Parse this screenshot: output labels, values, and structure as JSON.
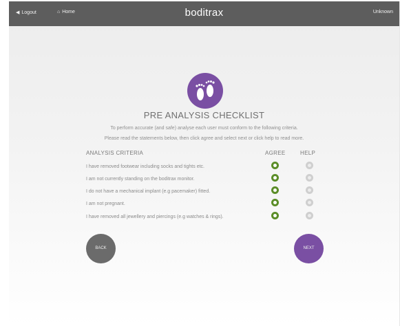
{
  "topbar": {
    "logout_label": "Logout",
    "home_label": "Home",
    "brand": "boditrax",
    "user_label": "Unknown"
  },
  "checklist": {
    "title": "PRE ANALYSIS CHECKLIST",
    "intro_line1": "To perform accurate (and safe) analyse each user must conform to the following criteria.",
    "intro_line2": "Please read the statements below, then click agree and select next or click help to read more.",
    "header_criteria": "ANALYSIS CRITERIA",
    "header_agree": "AGREE",
    "header_help": "HELP",
    "items": [
      {
        "text": "I have removed footwear including socks and tights etc.",
        "agreed": true
      },
      {
        "text": "I am not currently standing on the boditrax monitor.",
        "agreed": true
      },
      {
        "text": "I do not have a mechanical implant (e.g pacemaker) fitted.",
        "agreed": true
      },
      {
        "text": "I am not pregnant.",
        "agreed": true
      },
      {
        "text": "I have removed all jewellery and piercings (e.g watches & rings).",
        "agreed": true
      }
    ]
  },
  "buttons": {
    "back_label": "BACK",
    "next_label": "NEXT"
  },
  "colors": {
    "accent": "#7a4fa3",
    "agree": "#5b8d28",
    "topbar": "#5d5d5d"
  },
  "icons": {
    "logout": "arrow-left-icon",
    "home": "home-icon",
    "logo": "footprints-icon"
  }
}
